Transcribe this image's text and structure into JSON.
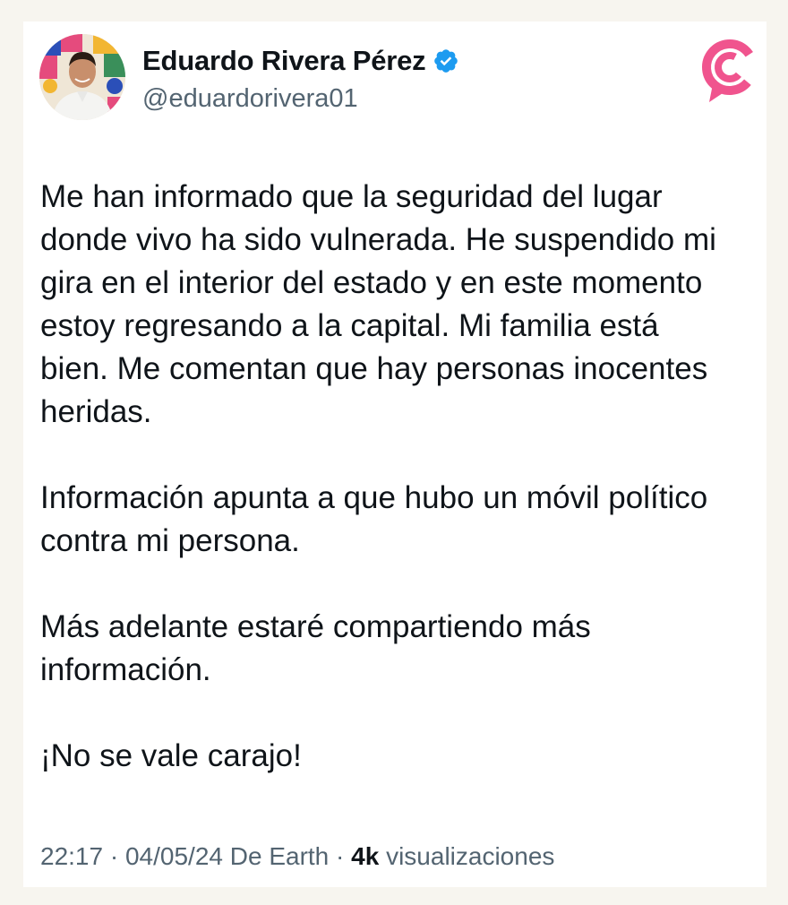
{
  "tweet": {
    "author_name": "Eduardo Rivera Pérez",
    "author_handle": "@eduardorivera01",
    "verified": true,
    "paragraphs": [
      "Me han informado que la seguridad del lugar\ndonde vivo ha sido vulnerada. He suspendido mi\ngira en el interior del estado y en este momento\nestoy regresando a la capital. Mi familia está\nbien. Me comentan que hay personas inocentes\nheridas.",
      "Información apunta a que hubo un móvil político\ncontra mi persona.",
      "Más adelante estaré compartiendo más\ninformación.",
      "¡No se vale carajo!"
    ],
    "time": "22:17",
    "date": "04/05/24",
    "source": "De Earth",
    "separator": "·",
    "views_count": "4k",
    "views_label": "visualizaciones"
  },
  "colors": {
    "background": "#f7f5ef",
    "card": "#ffffff",
    "text": "#0f1419",
    "muted": "#536471",
    "verified_badge": "#1d9bf0",
    "logo_accent": "#f0548e"
  },
  "icons": {
    "verified": "verified-badge-icon",
    "logo": "outlet-logo-icon"
  }
}
